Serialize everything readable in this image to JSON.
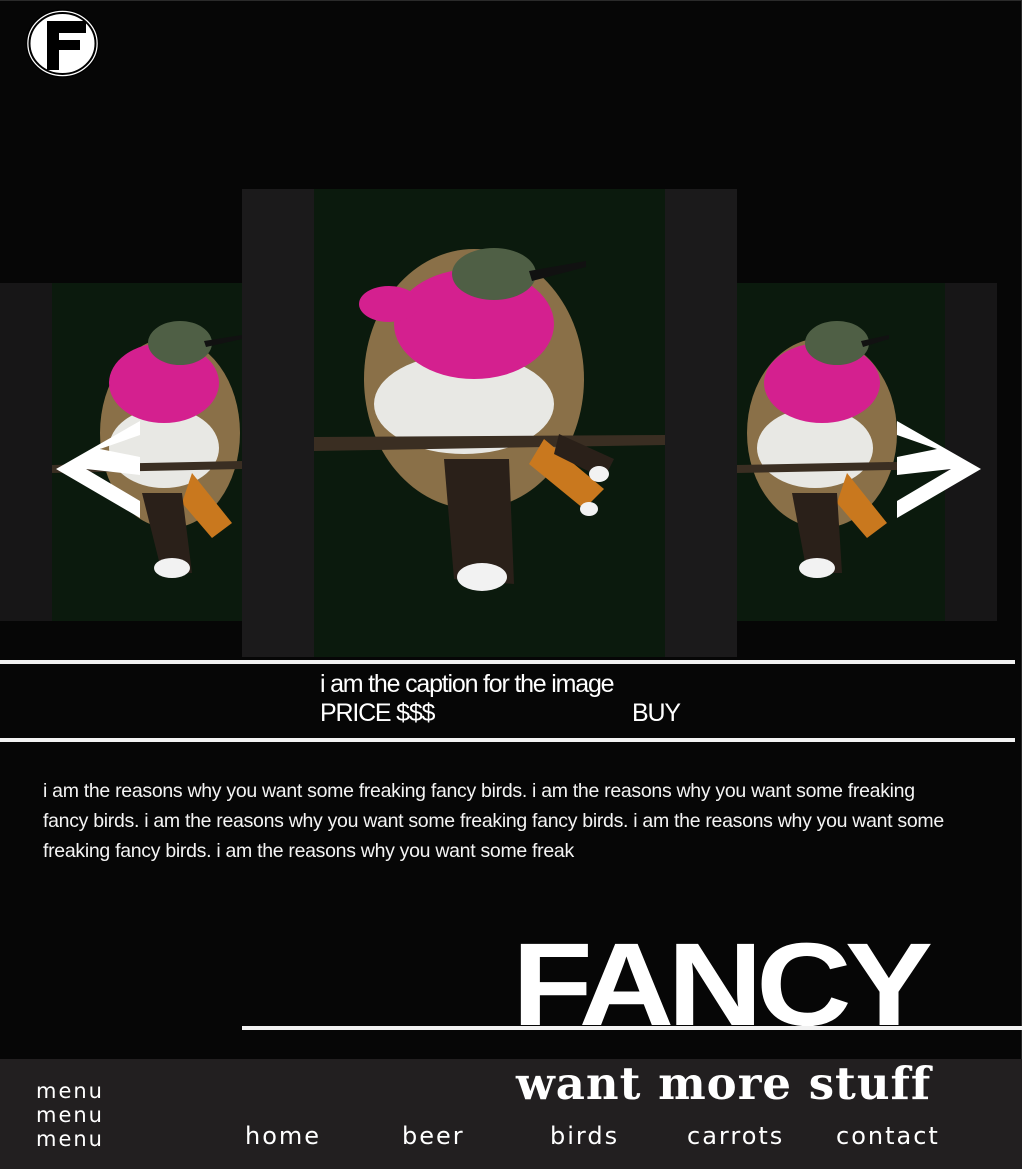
{
  "logo": {
    "letter": "F",
    "icon": "f-circle-logo"
  },
  "carousel": {
    "prev_icon": "chevron-left-icon",
    "next_icon": "chevron-right-icon",
    "caption": "i am the caption for the image",
    "price": "PRICE $$$",
    "buy_label": "BUY"
  },
  "description": "i am the reasons why you want some freaking fancy birds. i am the reasons why you want some freaking fancy birds. i am the reasons why you want some freaking fancy birds. i am the reasons why you want some freaking fancy birds. i am the reasons why you want some freak",
  "brand": {
    "title": "FANCY",
    "tagline": "want more stuff"
  },
  "menu": {
    "items": [
      "menu",
      "menu",
      "menu"
    ]
  },
  "nav": {
    "home": "home",
    "beer": "beer",
    "birds": "birds",
    "carrots": "carrots",
    "contact": "contact"
  },
  "colors": {
    "background": "#060606",
    "footer": "#221f20",
    "accent_magenta": "#d4208f",
    "text": "#ffffff"
  }
}
